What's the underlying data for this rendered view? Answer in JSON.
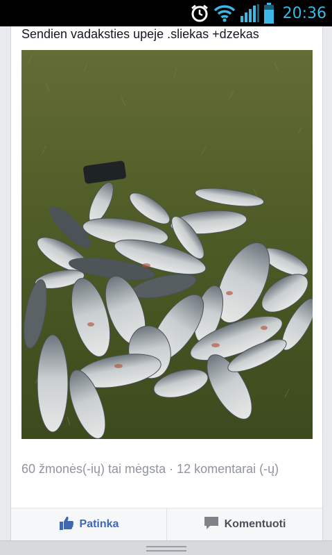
{
  "status_bar": {
    "time": "20:36",
    "icons": [
      "alarm-clock-icon",
      "wifi-icon",
      "signal-icon",
      "battery-icon"
    ],
    "accent_color": "#3ab8e6"
  },
  "post": {
    "text": "Sendien vadaksties upeje .sliekas +dzekas",
    "photo_subject": "fish-catch-photo",
    "likes_comments": "60 žmonės(-ių) tai mėgsta · 12 komentarai (-ų)"
  },
  "actions": {
    "like_label": "Patinka",
    "comment_label": "Komentuoti",
    "like_color": "#4267b2"
  }
}
